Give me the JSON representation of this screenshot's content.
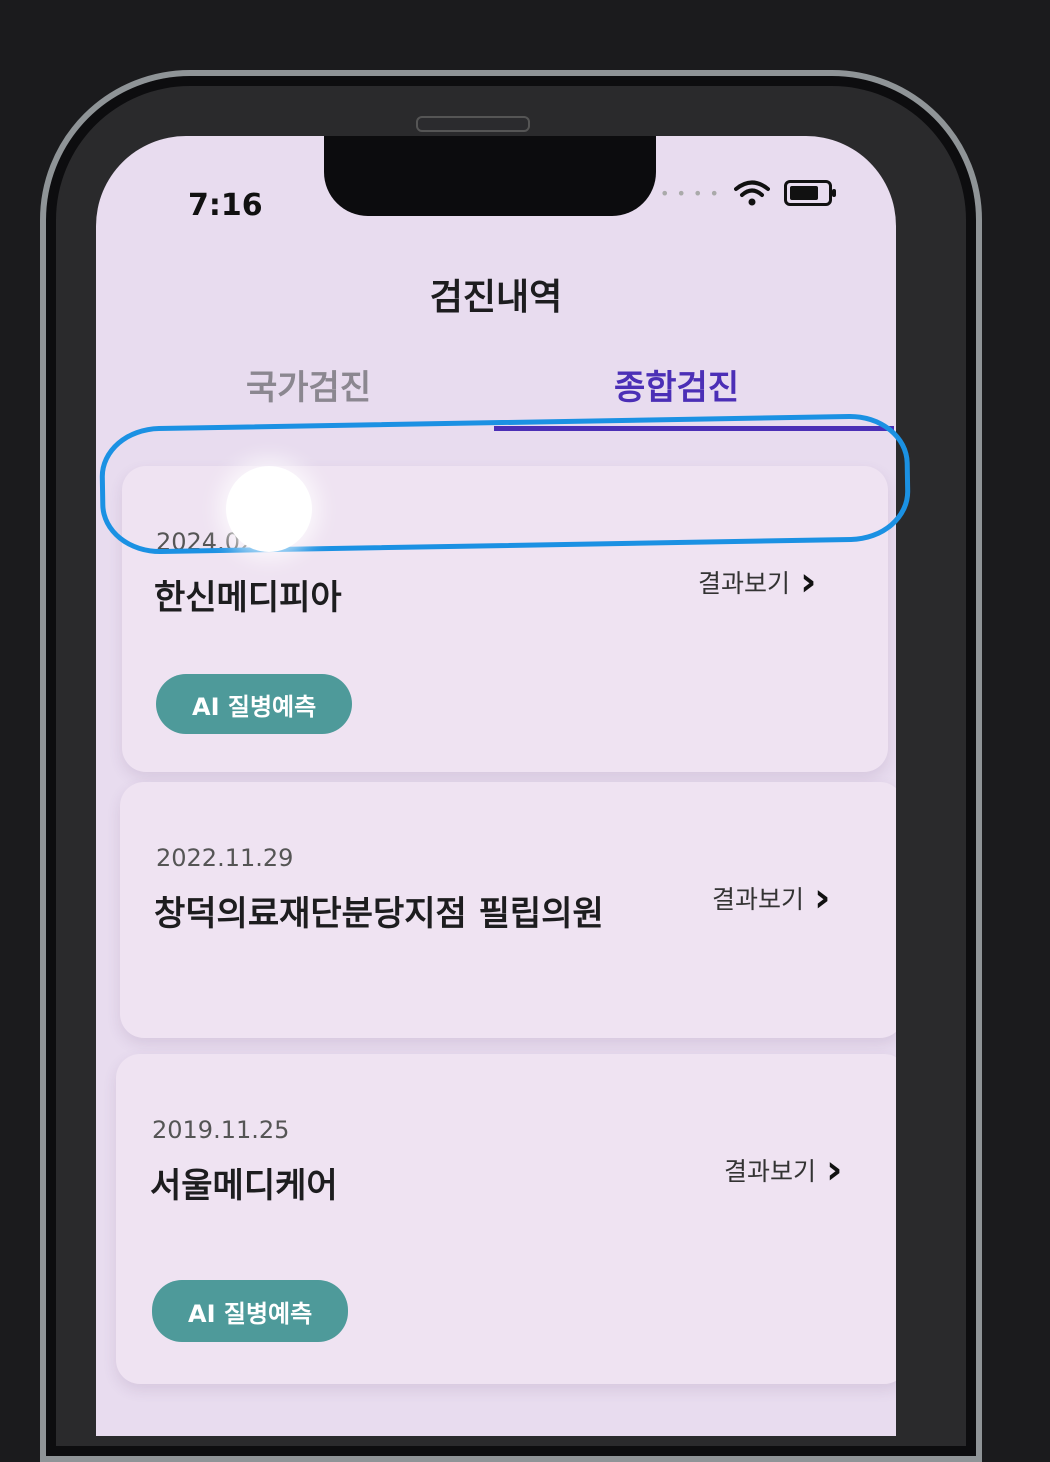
{
  "status_bar": {
    "time": "7:16"
  },
  "header": {
    "title": "검진내역"
  },
  "tabs": [
    {
      "label": "국가검진",
      "active": false
    },
    {
      "label": "종합검진",
      "active": true
    }
  ],
  "colors": {
    "accent": "#4b2fb6",
    "badge": "#4e9a9a",
    "annotation": "#1b91e3",
    "screen_bg": "#e8dcef"
  },
  "records": [
    {
      "date": "2024.02",
      "hospital": "한신메디피아",
      "action": "결과보기",
      "badge": "AI 질병예측"
    },
    {
      "date": "2022.11.29",
      "hospital": "창덕의료재단분당지점 필립의원",
      "action": "결과보기",
      "badge": ""
    },
    {
      "date": "2019.11.25",
      "hospital": "서울메디케어",
      "action": "결과보기",
      "badge": "AI 질병예측"
    }
  ]
}
